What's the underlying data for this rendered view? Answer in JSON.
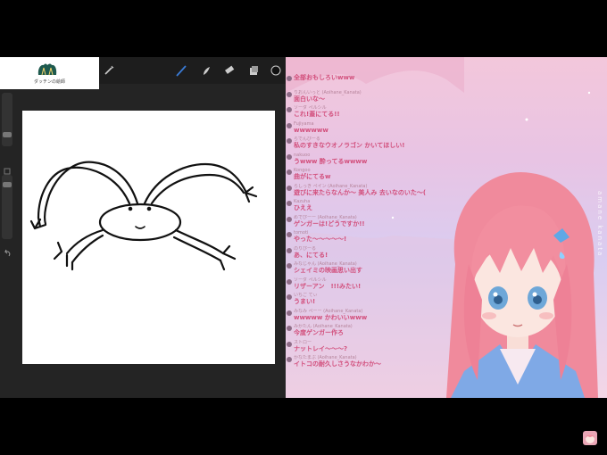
{
  "logo": {
    "text": "ダッチンの絵師",
    "icon": "cat-logo-icon"
  },
  "toolbar": {
    "icons": [
      "wrench-icon",
      "wand-icon",
      "brush-icon",
      "smudge-icon",
      "eraser-icon",
      "layers-icon",
      "color-icon"
    ]
  },
  "overlay": {
    "vertical_tag": "amane kanata"
  },
  "chat": {
    "messages": [
      {
        "name": "",
        "text": "全部おもしろいwww"
      },
      {
        "name": "りおんいっと (Aoihane_Kanata)",
        "text": "面白いな〜"
      },
      {
        "name": "ソーダ ペルシル",
        "text": "これ!蓋にてる!!"
      },
      {
        "name": "Fujiyama",
        "text": "wwwwww"
      },
      {
        "name": "らでんぴーる",
        "text": "私のすきなウオノラゴン かいてほしい!"
      },
      {
        "name": "nakuoo",
        "text": "うwww 酔ってるwwww"
      },
      {
        "name": "Kongoo",
        "text": "曲がにてるw"
      },
      {
        "name": "らしっき ペイン (Aoihane_Kanata)",
        "text": "遊びに来たらなんか〜 美人み 去いなのいた〜("
      },
      {
        "name": "Kazuha",
        "text": "ひええ"
      },
      {
        "name": "めでぴーー (Aoihane_Kanata)",
        "text": "ゲンガーは!どうですか!!"
      },
      {
        "name": "tomoti",
        "text": "やった〜〜〜〜〜!"
      },
      {
        "name": "のりぴーる",
        "text": "あ、にてる!"
      },
      {
        "name": "みなじゃん (Aoihane_Kanata)",
        "text": "シェイミの映画思い出す"
      },
      {
        "name": "ソーダ ペルシル",
        "text": "リザーアン　!!!みたい!"
      },
      {
        "name": "いちご てぃ",
        "text": "うまい!"
      },
      {
        "name": "みなみ ぺーー (Aoihane_Kanata)",
        "text": "wwwww かわいいwww"
      },
      {
        "name": "みかたん (Aoihane_Kanata)",
        "text": "今度ゲンガー作ろ"
      },
      {
        "name": "ストロー",
        "text": "ナットレイ〜〜〜?"
      },
      {
        "name": "かなたまぶ (Aoihane_Kanata)",
        "text": "イトコの耐久しさうなかわか〜"
      }
    ]
  },
  "colors": {
    "chat_text": "#d24f7c",
    "chat_name": "#b5839a",
    "canvas": "#ffffff",
    "app_bg": "#242424",
    "accent_brush": "#3a7bd5"
  }
}
